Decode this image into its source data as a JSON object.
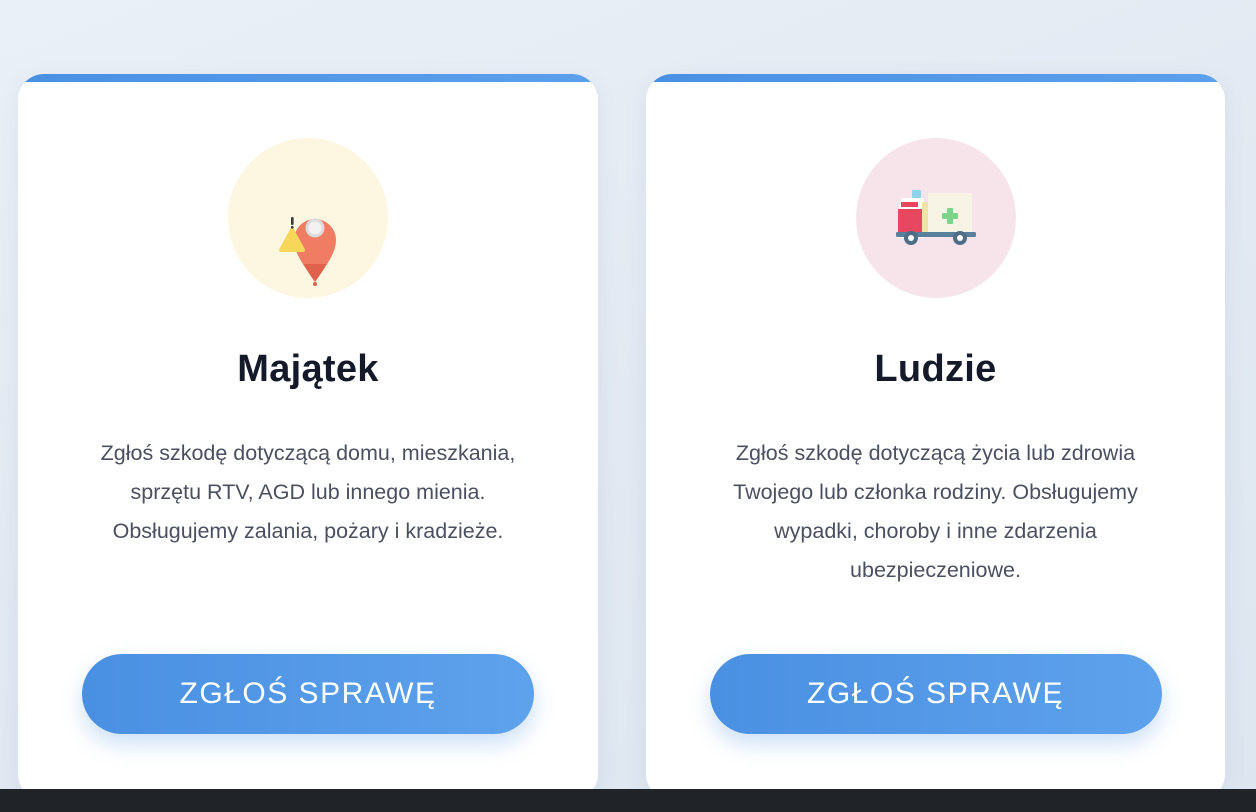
{
  "cards": [
    {
      "title": "Majątek",
      "description": "Zgłoś szkodę dotyczącą domu, mieszkania, sprzętu RTV, AGD lub innego mienia. Obsługujemy zalania, pożary i kradzieże.",
      "icon": "location-pin-warning-icon",
      "button_label": "ZGŁOŚ SPRAWĘ"
    },
    {
      "title": "Ludzie",
      "description": "Zgłoś szkodę dotyczącą życia lub zdrowia Twojego lub członka rodziny. Obsługujemy wypadki, choroby i inne zdarzenia ubezpieczeniowe.",
      "icon": "ambulance-icon",
      "button_label": "ZGŁOŚ SPRAWĘ"
    }
  ],
  "colors": {
    "accent": "#4a90e2",
    "title": "#151a2b",
    "text": "#4a5061",
    "icon_bg_property": "#fdf6e0",
    "icon_bg_people": "#f6e4ea"
  }
}
